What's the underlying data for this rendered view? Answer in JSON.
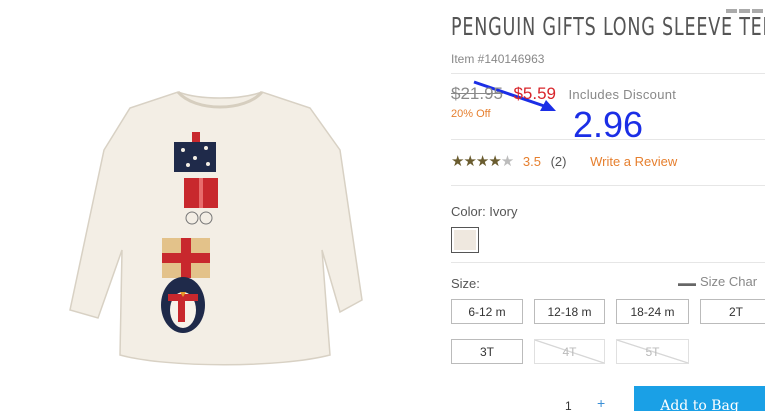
{
  "product": {
    "title": "PENGUIN GIFTS LONG SLEEVE TEE",
    "item_number": "Item #140146963",
    "image_alt": "long-sleeve-tee-image"
  },
  "price": {
    "original": "$21.95",
    "sale": "$5.59",
    "note": "Includes Discount",
    "discount": "20% Off"
  },
  "annotation": {
    "text": "2.96",
    "color": "#1b2ee6"
  },
  "rating": {
    "value": "3.5",
    "count": "(2)",
    "write_review": "Write a Review",
    "stars_filled": 3.5,
    "stars_total": 5
  },
  "color": {
    "label": "Color: Ivory",
    "swatch": "#efe8df"
  },
  "size": {
    "label": "Size:",
    "chart_link": "Size Char",
    "options": [
      {
        "label": "6-12 m",
        "available": true
      },
      {
        "label": "12-18 m",
        "available": true
      },
      {
        "label": "18-24 m",
        "available": true
      },
      {
        "label": "2T",
        "available": true
      },
      {
        "label": "3T",
        "available": true
      },
      {
        "label": "4T",
        "available": false
      },
      {
        "label": "5T",
        "available": false
      }
    ]
  },
  "cart": {
    "quantity": "1",
    "plus": "+",
    "add_label": "Add to Bag"
  },
  "colors": {
    "accent_blue": "#1aa0e6",
    "sale_red": "#d8252b",
    "orange": "#e67f2e"
  }
}
